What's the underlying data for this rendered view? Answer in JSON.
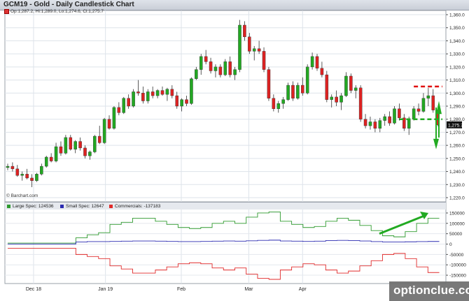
{
  "header": {
    "title": "GCM19 - Gold - Daily Candlestick Chart"
  },
  "ohlc_label": "Op:1,287.2, Hi:1,289.0, Lo:1,274.6, Cl:1,275.7",
  "attribution": "© Barchart.com",
  "watermark": "optionclue.com",
  "colors": {
    "up": "#22a822",
    "down": "#dd2222",
    "large_spec": "#2e9a2e",
    "small_spec": "#2a2ab0",
    "commercials": "#e02a2a",
    "arrow": "#22aa22",
    "dash_red": "#e01010",
    "dash_green": "#22aa22"
  },
  "chart_data": [
    {
      "type": "candlestick",
      "title": "GCM19 - Gold - Daily Candlestick Chart",
      "x_labels": [
        "Dec 18",
        "Jan 19",
        "Feb",
        "Mar",
        "Apr"
      ],
      "ylim": [
        1220,
        1360
      ],
      "yticks": [
        1220,
        1230,
        1240,
        1250,
        1260,
        1270,
        1280,
        1290,
        1300,
        1310,
        1320,
        1330,
        1340,
        1350,
        1360
      ],
      "ytick_labels": [
        "1,220.0",
        "1,230.0",
        "1,240.0",
        "1,250.0",
        "1,260.0",
        "1,270.0",
        "1,280.0",
        "1,290.0",
        "1,300.0",
        "1,310.0",
        "1,320.0",
        "1,330.0",
        "1,340.0",
        "1,350.0",
        "1,360.0"
      ],
      "last_price_label": "1,275.7",
      "grid": true,
      "candles": [
        [
          1243,
          1246,
          1241,
          1244
        ],
        [
          1244,
          1247,
          1240,
          1242
        ],
        [
          1242,
          1245,
          1236,
          1237
        ],
        [
          1237,
          1240,
          1233,
          1238
        ],
        [
          1238,
          1242,
          1234,
          1235
        ],
        [
          1235,
          1238,
          1228,
          1233
        ],
        [
          1233,
          1239,
          1232,
          1238
        ],
        [
          1238,
          1246,
          1237,
          1244
        ],
        [
          1244,
          1252,
          1243,
          1251
        ],
        [
          1251,
          1254,
          1247,
          1248
        ],
        [
          1248,
          1262,
          1247,
          1259
        ],
        [
          1259,
          1263,
          1252,
          1254
        ],
        [
          1254,
          1268,
          1253,
          1266
        ],
        [
          1266,
          1268,
          1256,
          1257
        ],
        [
          1257,
          1264,
          1254,
          1263
        ],
        [
          1263,
          1266,
          1256,
          1258
        ],
        [
          1258,
          1260,
          1250,
          1252
        ],
        [
          1252,
          1256,
          1249,
          1255
        ],
        [
          1255,
          1268,
          1254,
          1267
        ],
        [
          1267,
          1275,
          1261,
          1262
        ],
        [
          1262,
          1281,
          1261,
          1280
        ],
        [
          1280,
          1283,
          1272,
          1273
        ],
        [
          1273,
          1290,
          1272,
          1289
        ],
        [
          1289,
          1293,
          1283,
          1285
        ],
        [
          1285,
          1297,
          1284,
          1296
        ],
        [
          1296,
          1299,
          1288,
          1290
        ],
        [
          1290,
          1303,
          1289,
          1301
        ],
        [
          1301,
          1310,
          1298,
          1300
        ],
        [
          1300,
          1305,
          1292,
          1294
        ],
        [
          1294,
          1303,
          1292,
          1301
        ],
        [
          1301,
          1305,
          1296,
          1298
        ],
        [
          1298,
          1303,
          1296,
          1302
        ],
        [
          1302,
          1305,
          1298,
          1299
        ],
        [
          1299,
          1304,
          1294,
          1303
        ],
        [
          1303,
          1306,
          1296,
          1298
        ],
        [
          1298,
          1301,
          1288,
          1290
        ],
        [
          1290,
          1296,
          1286,
          1295
        ],
        [
          1295,
          1298,
          1290,
          1292
        ],
        [
          1292,
          1312,
          1291,
          1311
        ],
        [
          1311,
          1320,
          1310,
          1318
        ],
        [
          1318,
          1330,
          1314,
          1328
        ],
        [
          1328,
          1333,
          1322,
          1324
        ],
        [
          1324,
          1327,
          1315,
          1317
        ],
        [
          1317,
          1322,
          1312,
          1320
        ],
        [
          1320,
          1322,
          1312,
          1314
        ],
        [
          1314,
          1326,
          1313,
          1324
        ],
        [
          1324,
          1328,
          1312,
          1314
        ],
        [
          1314,
          1320,
          1310,
          1318
        ],
        [
          1318,
          1356,
          1316,
          1352
        ],
        [
          1352,
          1355,
          1340,
          1343
        ],
        [
          1343,
          1346,
          1330,
          1332
        ],
        [
          1332,
          1336,
          1325,
          1334
        ],
        [
          1334,
          1340,
          1330,
          1332
        ],
        [
          1332,
          1335,
          1316,
          1318
        ],
        [
          1318,
          1320,
          1294,
          1296
        ],
        [
          1296,
          1299,
          1286,
          1288
        ],
        [
          1288,
          1294,
          1285,
          1292
        ],
        [
          1292,
          1297,
          1288,
          1295
        ],
        [
          1295,
          1308,
          1294,
          1306
        ],
        [
          1306,
          1309,
          1294,
          1296
        ],
        [
          1296,
          1308,
          1295,
          1306
        ],
        [
          1306,
          1312,
          1298,
          1300
        ],
        [
          1300,
          1322,
          1299,
          1320
        ],
        [
          1320,
          1331,
          1318,
          1328
        ],
        [
          1328,
          1330,
          1317,
          1319
        ],
        [
          1319,
          1324,
          1312,
          1314
        ],
        [
          1314,
          1317,
          1293,
          1295
        ],
        [
          1295,
          1299,
          1289,
          1297
        ],
        [
          1297,
          1302,
          1290,
          1293
        ],
        [
          1293,
          1300,
          1287,
          1298
        ],
        [
          1298,
          1316,
          1297,
          1313
        ],
        [
          1313,
          1315,
          1300,
          1302
        ],
        [
          1302,
          1306,
          1296,
          1304
        ],
        [
          1304,
          1306,
          1278,
          1280
        ],
        [
          1280,
          1284,
          1273,
          1275
        ],
        [
          1275,
          1282,
          1272,
          1278
        ],
        [
          1278,
          1280,
          1270,
          1273
        ],
        [
          1273,
          1281,
          1270,
          1279
        ],
        [
          1279,
          1284,
          1275,
          1282
        ],
        [
          1282,
          1286,
          1275,
          1277
        ],
        [
          1277,
          1290,
          1276,
          1288
        ],
        [
          1288,
          1292,
          1279,
          1281
        ],
        [
          1281,
          1284,
          1271,
          1273
        ],
        [
          1273,
          1282,
          1268,
          1280
        ],
        [
          1280,
          1290,
          1279,
          1288
        ],
        [
          1288,
          1292,
          1283,
          1286
        ],
        [
          1286,
          1300,
          1285,
          1296
        ],
        [
          1296,
          1304,
          1290,
          1298
        ],
        [
          1298,
          1303,
          1285,
          1287
        ],
        [
          1287.2,
          1289.0,
          1274.6,
          1275.7
        ]
      ]
    },
    {
      "type": "line",
      "subtype": "step",
      "ylim": [
        -170000,
        160000
      ],
      "yticks": [
        150000,
        100000,
        50000,
        0,
        -50000,
        -100000,
        -150000
      ],
      "ytick_labels": [
        "150000",
        "100000",
        "50000",
        "0",
        "-50000",
        "-100000",
        "-150000"
      ],
      "series": [
        {
          "name": "Large Spec: 124536",
          "color_key": "large_spec",
          "values": [
            5000,
            5000,
            5000,
            5000,
            5000,
            5000,
            30000,
            45000,
            55000,
            95000,
            105000,
            125000,
            125000,
            110000,
            95000,
            80000,
            75000,
            80000,
            100000,
            110000,
            100000,
            130000,
            150000,
            155000,
            110000,
            95000,
            80000,
            85000,
            110000,
            125000,
            115000,
            90000,
            65000,
            40000,
            35000,
            60000,
            100000,
            124536
          ]
        },
        {
          "name": "Small Spec: 12647",
          "color_key": "small_spec",
          "values": [
            0,
            0,
            0,
            0,
            0,
            0,
            10000,
            12000,
            12000,
            13000,
            14000,
            15000,
            15000,
            14000,
            13000,
            12000,
            12000,
            13000,
            14000,
            15000,
            14000,
            16000,
            18000,
            19000,
            15000,
            14000,
            13000,
            14000,
            17000,
            18000,
            17000,
            15000,
            12000,
            10000,
            10000,
            11000,
            12000,
            12647
          ]
        },
        {
          "name": "Commercials: -137183",
          "color_key": "commercials",
          "values": [
            -20000,
            -20000,
            -20000,
            -20000,
            -20000,
            -20000,
            -50000,
            -60000,
            -70000,
            -105000,
            -120000,
            -140000,
            -140000,
            -125000,
            -110000,
            -95000,
            -90000,
            -95000,
            -115000,
            -125000,
            -115000,
            -145000,
            -165000,
            -170000,
            -125000,
            -110000,
            -95000,
            -100000,
            -125000,
            -140000,
            -130000,
            -105000,
            -80000,
            -50000,
            -45000,
            -70000,
            -110000,
            -137183
          ]
        }
      ]
    }
  ]
}
